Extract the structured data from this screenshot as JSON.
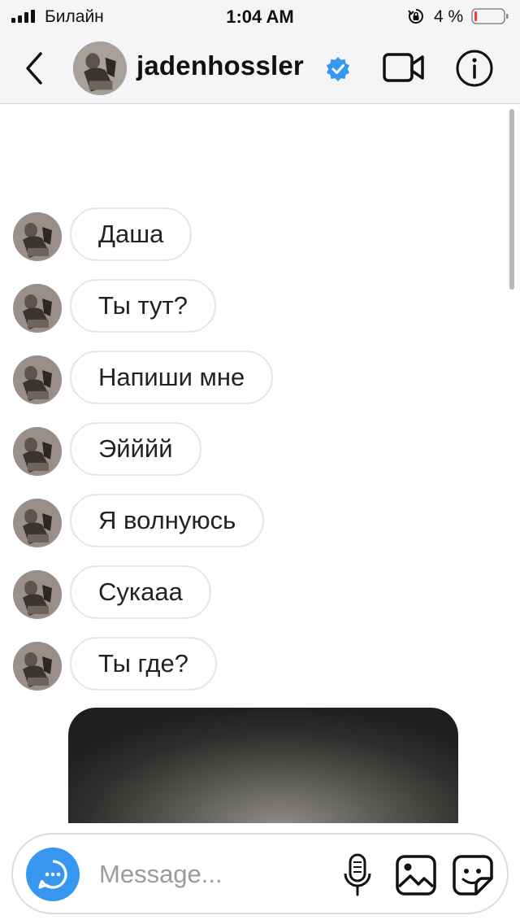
{
  "status_bar": {
    "carrier": "Билайн",
    "time": "1:04 AM",
    "battery": "4 %",
    "battery_color": "#ff3b30"
  },
  "header": {
    "username": "jadenhossler",
    "verified": true,
    "icons": [
      "chevron-left-icon",
      "video-camera-icon",
      "info-icon",
      "verified-badge-icon"
    ]
  },
  "messages": [
    {
      "text": "Даша"
    },
    {
      "text": "Ты тут?"
    },
    {
      "text": "Напиши мне"
    },
    {
      "text": "Эйййй"
    },
    {
      "text": "Я волнуюсь"
    },
    {
      "text": "Сукааа"
    },
    {
      "text": "Ты где?"
    }
  ],
  "composer": {
    "placeholder": "Message...",
    "value": "",
    "icons": [
      "camera-search-icon",
      "microphone-icon",
      "gallery-icon",
      "sticker-icon"
    ]
  },
  "colors": {
    "accent": "#3797f0",
    "verified": "#3897f0",
    "bubble_border": "#e5e5ea"
  }
}
